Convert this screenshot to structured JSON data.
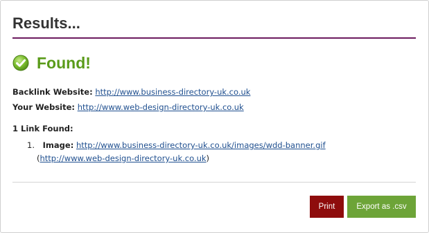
{
  "header": {
    "title": "Results..."
  },
  "status": {
    "icon": "check-circle-icon",
    "text": "Found!",
    "color": "#5a9b1a"
  },
  "details": {
    "backlink_label": "Backlink Website:",
    "backlink_url": "http://www.business-directory-uk.co.uk",
    "your_label": "Your Website:",
    "your_url": "http://www.web-design-directory-uk.co.uk"
  },
  "links": {
    "count_text": "1 Link Found:",
    "items": [
      {
        "number": "1.",
        "type_label": "Image:",
        "url": "http://www.business-directory-uk.co.uk/images/wdd-banner.gif",
        "target_open": "(",
        "target_url": "http://www.web-design-directory-uk.co.uk",
        "target_close": ")"
      }
    ]
  },
  "actions": {
    "print_label": "Print",
    "export_label": "Export as .csv"
  },
  "colors": {
    "accent_rule": "#6b1a5e",
    "print_button": "#8e0c0c",
    "export_button": "#6da438",
    "link": "#1f4f8f"
  }
}
